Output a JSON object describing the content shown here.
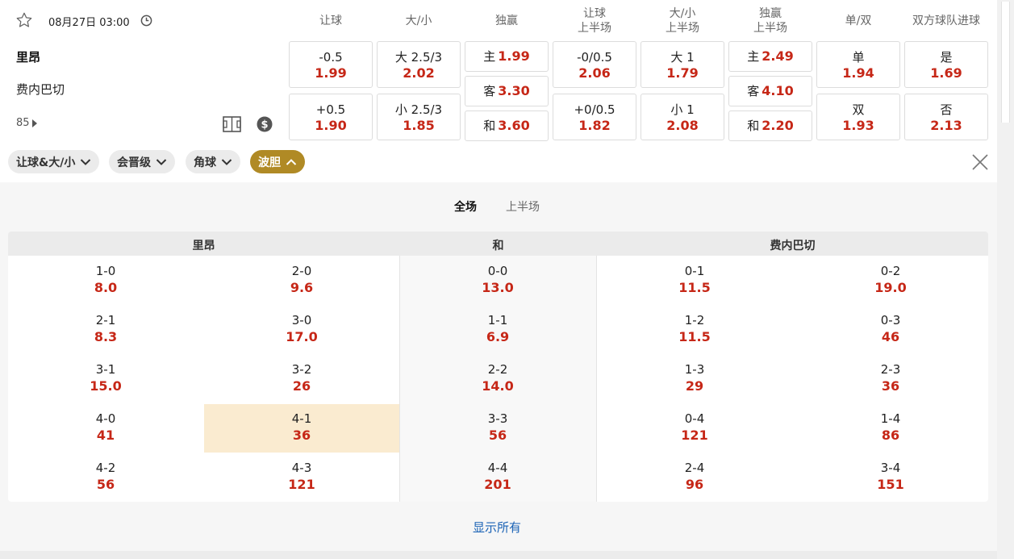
{
  "match": {
    "date_time": "08月27日 03:00",
    "home": "里昂",
    "away": "费内巴切",
    "minute": "85"
  },
  "columns": [
    {
      "line1": "让球",
      "line2": ""
    },
    {
      "line1": "大/小",
      "line2": ""
    },
    {
      "line1": "独赢",
      "line2": ""
    },
    {
      "line1": "让球",
      "line2": "上半场"
    },
    {
      "line1": "大/小",
      "line2": "上半场"
    },
    {
      "line1": "独赢",
      "line2": "上半场"
    },
    {
      "line1": "单/双",
      "line2": ""
    },
    {
      "line1": "双方球队进球",
      "line2": ""
    }
  ],
  "odds": {
    "handicap": [
      {
        "label": "-0.5",
        "odd": "1.99"
      },
      {
        "label": "+0.5",
        "odd": "1.90"
      }
    ],
    "total": [
      {
        "label": "大 2.5/3",
        "odd": "2.02"
      },
      {
        "label": "小 2.5/3",
        "odd": "1.85"
      }
    ],
    "moneyline": [
      {
        "label": "主",
        "odd": "1.99"
      },
      {
        "label": "客",
        "odd": "3.30"
      },
      {
        "label": "和",
        "odd": "3.60"
      }
    ],
    "handicap_1h": [
      {
        "label": "-0/0.5",
        "odd": "2.06"
      },
      {
        "label": "+0/0.5",
        "odd": "1.82"
      }
    ],
    "total_1h": [
      {
        "label": "大 1",
        "odd": "1.79"
      },
      {
        "label": "小 1",
        "odd": "2.08"
      }
    ],
    "moneyline_1h": [
      {
        "label": "主",
        "odd": "2.49"
      },
      {
        "label": "客",
        "odd": "4.10"
      },
      {
        "label": "和",
        "odd": "2.20"
      }
    ],
    "odd_even": [
      {
        "label": "单",
        "odd": "1.94"
      },
      {
        "label": "双",
        "odd": "1.93"
      }
    ],
    "btts": [
      {
        "label": "是",
        "odd": "1.69"
      },
      {
        "label": "否",
        "odd": "2.13"
      }
    ]
  },
  "filters": [
    {
      "label": "让球&大/小",
      "active": false
    },
    {
      "label": "会晋级",
      "active": false
    },
    {
      "label": "角球",
      "active": false
    },
    {
      "label": "波胆",
      "active": true
    }
  ],
  "tabs": {
    "full": "全场",
    "half": "上半场"
  },
  "correct_score": {
    "headers": {
      "home": "里昂",
      "draw": "和",
      "away": "费内巴切"
    },
    "home_a": [
      {
        "s": "1-0",
        "o": "8.0"
      },
      {
        "s": "2-1",
        "o": "8.3"
      },
      {
        "s": "3-1",
        "o": "15.0"
      },
      {
        "s": "4-0",
        "o": "41"
      },
      {
        "s": "4-2",
        "o": "56"
      }
    ],
    "home_b": [
      {
        "s": "2-0",
        "o": "9.6"
      },
      {
        "s": "3-0",
        "o": "17.0"
      },
      {
        "s": "3-2",
        "o": "26"
      },
      {
        "s": "4-1",
        "o": "36"
      },
      {
        "s": "4-3",
        "o": "121"
      }
    ],
    "draw": [
      {
        "s": "0-0",
        "o": "13.0"
      },
      {
        "s": "1-1",
        "o": "6.9"
      },
      {
        "s": "2-2",
        "o": "14.0"
      },
      {
        "s": "3-3",
        "o": "56"
      },
      {
        "s": "4-4",
        "o": "201"
      }
    ],
    "away_a": [
      {
        "s": "0-1",
        "o": "11.5"
      },
      {
        "s": "1-2",
        "o": "11.5"
      },
      {
        "s": "1-3",
        "o": "29"
      },
      {
        "s": "0-4",
        "o": "121"
      },
      {
        "s": "2-4",
        "o": "96"
      }
    ],
    "away_b": [
      {
        "s": "0-2",
        "o": "19.0"
      },
      {
        "s": "0-3",
        "o": "46"
      },
      {
        "s": "2-3",
        "o": "36"
      },
      {
        "s": "1-4",
        "o": "86"
      },
      {
        "s": "3-4",
        "o": "151"
      }
    ]
  },
  "show_all": "显示所有",
  "colors": {
    "odd_red": "#c62717",
    "accent_gold": "#b08a25",
    "highlight": "#faebd0",
    "link_blue": "#1a62b5"
  }
}
